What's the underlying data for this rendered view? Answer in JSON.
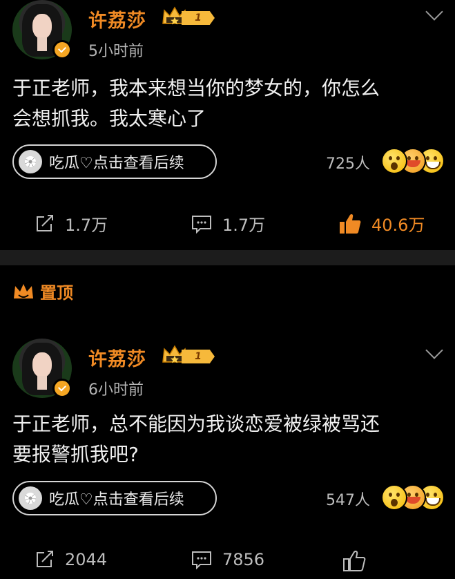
{
  "posts": [
    {
      "username": "许荔莎",
      "level": "1",
      "time": "5小时前",
      "text_line1": "于正老师，我本来想当你的梦女的，你怎么",
      "text_line2": "会想抓我。我太寒心了",
      "pill_label": "吃瓜♡点击查看后续",
      "reaction_count": "725人",
      "repost_count": "1.7万",
      "comment_count": "1.7万",
      "like_count": "40.6万"
    },
    {
      "pinned_label": "置顶",
      "username": "许荔莎",
      "level": "1",
      "time": "6小时前",
      "text_line1": "于正老师，总不能因为我谈恋爱被绿被骂还",
      "text_line2": "要报警抓我吧?",
      "pill_label": "吃瓜♡点击查看后续",
      "reaction_count": "547人",
      "repost_count": "2044",
      "comment_count": "7856"
    }
  ],
  "colors": {
    "accent": "#f08a24",
    "background": "#000000",
    "text": "#f0f0f0",
    "muted": "#bdbdbd",
    "badge": "#f6b93b"
  },
  "icons": [
    "avatar",
    "verified-badge-icon",
    "crown-icon",
    "chevron-down-icon",
    "melon-icon",
    "emoji-icon",
    "repost-icon",
    "comment-icon",
    "like-icon"
  ]
}
